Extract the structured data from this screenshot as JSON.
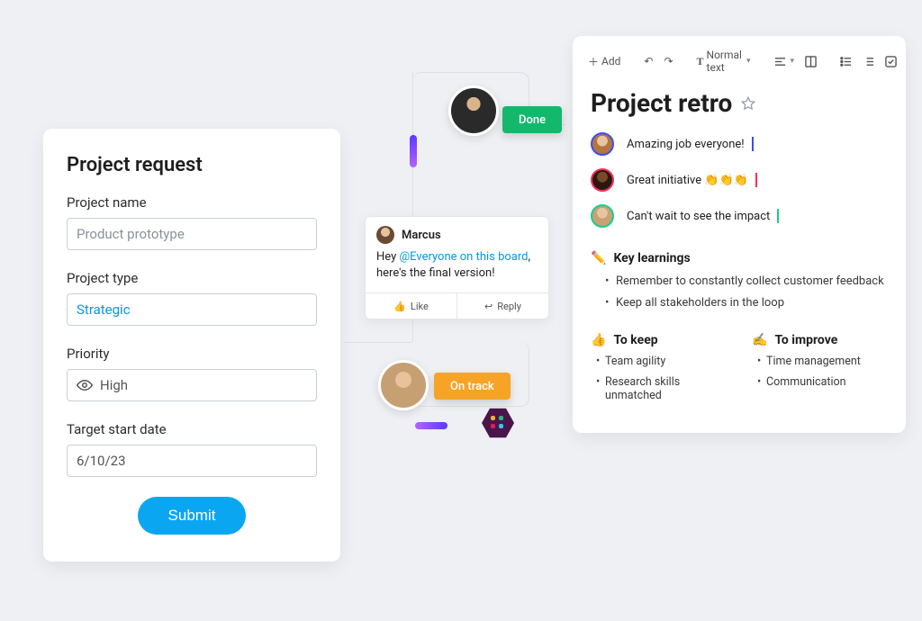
{
  "form": {
    "title": "Project request",
    "fields": {
      "name": {
        "label": "Project name",
        "value": "Product prototype"
      },
      "type": {
        "label": "Project type",
        "value": "Strategic"
      },
      "priority": {
        "label": "Priority",
        "value": "High"
      },
      "date": {
        "label": "Target start date",
        "value": "6/10/23"
      }
    },
    "submit_label": "Submit"
  },
  "center": {
    "status_done": "Done",
    "status_ontrack": "On track",
    "comment": {
      "author": "Marcus",
      "text_pre": "Hey ",
      "mention": "@Everyone on this board",
      "text_post": ", here's the final version!",
      "like_label": "Like",
      "reply_label": "Reply"
    }
  },
  "retro": {
    "toolbar": {
      "add_label": "Add",
      "style_label": "Normal text"
    },
    "title": "Project retro",
    "comments": [
      {
        "text": "Amazing job everyone!"
      },
      {
        "text": "Great initiative 👏👏👏"
      },
      {
        "text": "Can't wait to see the impact"
      }
    ],
    "sections": {
      "learnings": {
        "heading": "Key learnings",
        "items": [
          "Remember to constantly collect customer feedback",
          "Keep all stakeholders in the loop"
        ]
      },
      "keep": {
        "heading": "To keep",
        "items": [
          "Team agility",
          "Research skills unmatched"
        ]
      },
      "improve": {
        "heading": "To improve",
        "items": [
          "Time management",
          "Communication"
        ]
      }
    }
  }
}
